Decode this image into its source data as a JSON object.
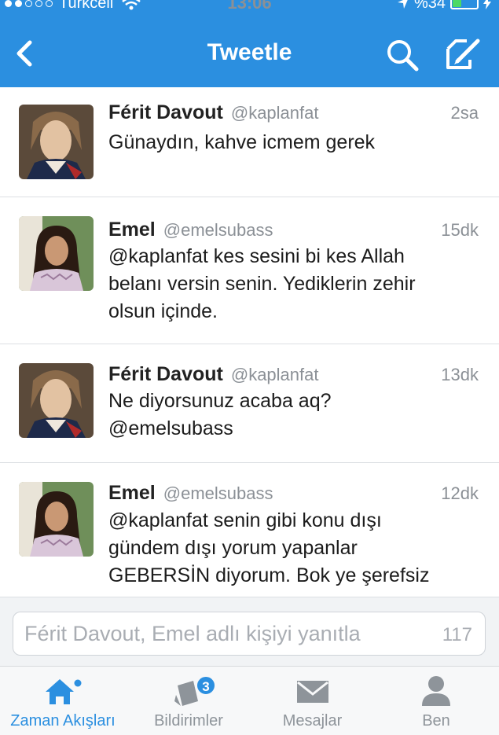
{
  "status_bar": {
    "carrier": "Turkcell",
    "time": "13:06",
    "battery": "%34"
  },
  "nav": {
    "title": "Tweetle",
    "back_icon": "chevron-left-icon",
    "search_icon": "search-icon",
    "compose_icon": "compose-icon"
  },
  "tweets": [
    {
      "name": "Férit Davout",
      "handle": "@kaplanfat",
      "time": "2sa",
      "lines": [
        "Günaydın, kahve icmem gerek"
      ]
    },
    {
      "name": "Emel",
      "handle": "@emelsubass",
      "time": "15dk",
      "lines": [
        "@kaplanfat kes sesini bi kes Allah",
        "belanı versin senin. Yediklerin zehir",
        "olsun içinde."
      ]
    },
    {
      "name": "Férit Davout",
      "handle": "@kaplanfat",
      "time": "13dk",
      "lines": [
        "Ne diyorsunuz acaba aq?",
        "@emelsubass"
      ]
    },
    {
      "name": "Emel",
      "handle": "@emelsubass",
      "time": "12dk",
      "lines": [
        "@kaplanfat senin gibi konu dışı",
        "gündem dışı yorum yapanlar",
        "GEBERSİN diyorum. Bok ye şerefsiz"
      ]
    }
  ],
  "reply": {
    "placeholder": "Férit Davout, Emel adlı kişiyi yanıtla",
    "char_count": "117"
  },
  "tabs": [
    {
      "label": "Zaman Akışları",
      "icon": "home-icon",
      "active": true
    },
    {
      "label": "Bildirimler",
      "icon": "notifications-icon",
      "badge": "3"
    },
    {
      "label": "Mesajlar",
      "icon": "envelope-icon"
    },
    {
      "label": "Ben",
      "icon": "person-icon"
    }
  ],
  "colors": {
    "accent": "#2b8fe0",
    "battery": "#4cd964"
  }
}
